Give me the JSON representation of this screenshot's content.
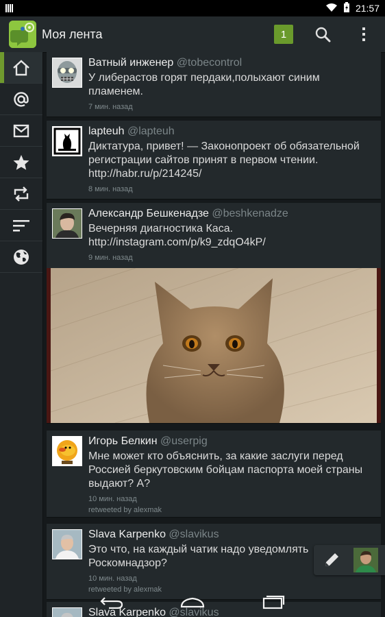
{
  "status": {
    "time": "21:57"
  },
  "header": {
    "title": "Моя лента",
    "unread_count": "1"
  },
  "icons": {
    "nav": [
      "home-icon",
      "mention-icon",
      "mail-icon",
      "star-icon",
      "retweet-icon",
      "lists-icon",
      "globe-icon"
    ]
  },
  "colors": {
    "accent": "#6f9a2e",
    "badge": "#6a9a2c",
    "background": "#15191b",
    "card": "#23292c"
  },
  "feed": {
    "tweets": [
      {
        "name": "Ватный инженер",
        "handle": "@tobecontrol",
        "text": "У либерастов горят пердаки,полыхают синим пламенем.",
        "time": "7 мин. назад",
        "retweet": ""
      },
      {
        "name": "lapteuh",
        "handle": "@lapteuh",
        "text": "Диктатура, привет! — Законопроект об обязательной регистрации сайтов принят в первом чтении. http://habr.ru/p/214245/",
        "time": "8 мин. назад",
        "retweet": ""
      },
      {
        "name": "Александр Бешкенадзе",
        "handle": "@beshkenadze",
        "text": "Вечерняя диагностика Каса. http://instagram.com/p/k9_zdqO4kP/",
        "time": "9 мин. назад",
        "retweet": ""
      },
      {
        "name": "Игорь Белкин",
        "handle": "@userpig",
        "text": "Мне может кто объяснить, за какие заслуги перед Россией  беркутовским бойцам паспорта моей страны выдают? А?",
        "time": "10 мин. назад",
        "retweet": "retweeted by alexmak"
      },
      {
        "name": "Slava Karpenko",
        "handle": "@slavikus",
        "text": "Это что, на каждый чатик надо уведомлять Роскомнадзор?",
        "time": "10 мин. назад",
        "retweet": "retweeted by alexmak"
      },
      {
        "name": "Slava Karpenko",
        "handle": "@slavikus",
        "text": "",
        "time": "",
        "retweet": ""
      }
    ]
  }
}
